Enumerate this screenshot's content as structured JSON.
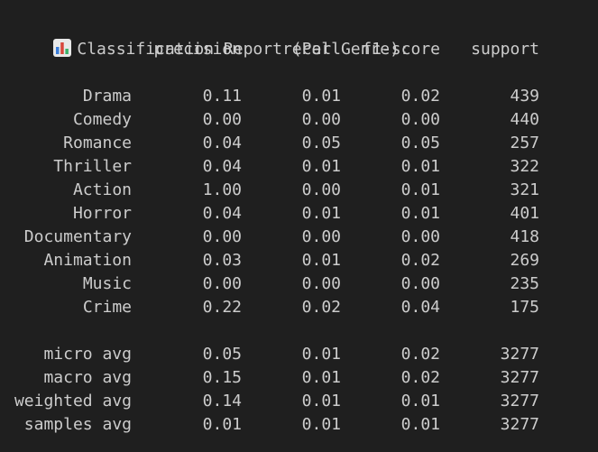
{
  "report": {
    "title": "Classification Report (Per Genre):",
    "icon": "bar-chart-icon",
    "columns": [
      "precision",
      "recall",
      "f1-score",
      "support"
    ],
    "rows": [
      {
        "label": "Drama",
        "precision": "0.11",
        "recall": "0.01",
        "f1": "0.02",
        "support": "439"
      },
      {
        "label": "Comedy",
        "precision": "0.00",
        "recall": "0.00",
        "f1": "0.00",
        "support": "440"
      },
      {
        "label": "Romance",
        "precision": "0.04",
        "recall": "0.05",
        "f1": "0.05",
        "support": "257"
      },
      {
        "label": "Thriller",
        "precision": "0.04",
        "recall": "0.01",
        "f1": "0.01",
        "support": "322"
      },
      {
        "label": "Action",
        "precision": "1.00",
        "recall": "0.00",
        "f1": "0.01",
        "support": "321"
      },
      {
        "label": "Horror",
        "precision": "0.04",
        "recall": "0.01",
        "f1": "0.01",
        "support": "401"
      },
      {
        "label": "Documentary",
        "precision": "0.00",
        "recall": "0.00",
        "f1": "0.00",
        "support": "418"
      },
      {
        "label": "Animation",
        "precision": "0.03",
        "recall": "0.01",
        "f1": "0.02",
        "support": "269"
      },
      {
        "label": "Music",
        "precision": "0.00",
        "recall": "0.00",
        "f1": "0.00",
        "support": "235"
      },
      {
        "label": "Crime",
        "precision": "0.22",
        "recall": "0.02",
        "f1": "0.04",
        "support": "175"
      }
    ],
    "averages": [
      {
        "label": "micro avg",
        "precision": "0.05",
        "recall": "0.01",
        "f1": "0.02",
        "support": "3277"
      },
      {
        "label": "macro avg",
        "precision": "0.15",
        "recall": "0.01",
        "f1": "0.02",
        "support": "3277"
      },
      {
        "label": "weighted avg",
        "precision": "0.14",
        "recall": "0.01",
        "f1": "0.01",
        "support": "3277"
      },
      {
        "label": "samples avg",
        "precision": "0.01",
        "recall": "0.01",
        "f1": "0.01",
        "support": "3277"
      }
    ]
  },
  "colors": {
    "background": "#1f1f1f",
    "text": "#cccccc"
  }
}
